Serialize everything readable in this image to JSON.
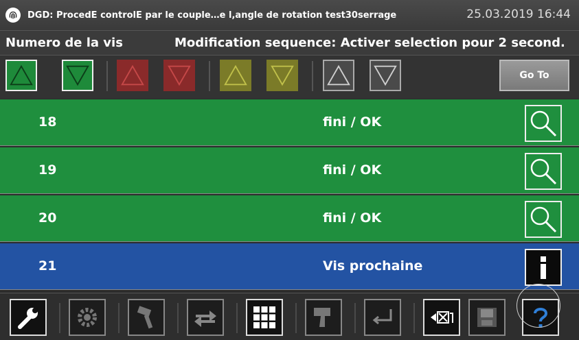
{
  "window": {
    "title": "DGD: ProcedE controlE par le couple…e l,angle de rotation test30serrage",
    "datetime": "25.03.2019 16:44",
    "logo_icon": "fingerprint-logo"
  },
  "header": {
    "col1": "Numero de la vis",
    "col2": "Modification sequence: Activer selection pour 2 second."
  },
  "toolbar": {
    "groups": [
      {
        "color": "green",
        "fill": "#1e8a3a",
        "stroke": "#0c3d18"
      },
      {
        "color": "red",
        "fill": "#8a2a2a",
        "stroke": "#c54848"
      },
      {
        "color": "yellow",
        "fill": "#7b7b28",
        "stroke": "#c0c04a"
      },
      {
        "color": "gray",
        "fill": "#4a4a4a",
        "stroke": "#cfcfcf"
      }
    ],
    "goto_label": "Go To"
  },
  "rows": [
    {
      "number": "18",
      "status": "fini / OK",
      "color": "#1f8f3e",
      "button": "search-icon"
    },
    {
      "number": "19",
      "status": "fini / OK",
      "color": "#1f8f3e",
      "button": "search-icon"
    },
    {
      "number": "20",
      "status": "fini / OK",
      "color": "#1f8f3e",
      "button": "search-icon"
    },
    {
      "number": "21",
      "status": "Vis prochaine",
      "color": "#2353a3",
      "button": "info-icon"
    }
  ],
  "bottombar": {
    "buttons": [
      "wrench-icon",
      "gear-icon",
      "tool-icon",
      "swap-arrows-icon",
      "grid-icon",
      "scanner-icon",
      "enter-icon",
      "delete-icon",
      "save-icon",
      "help-icon"
    ]
  }
}
